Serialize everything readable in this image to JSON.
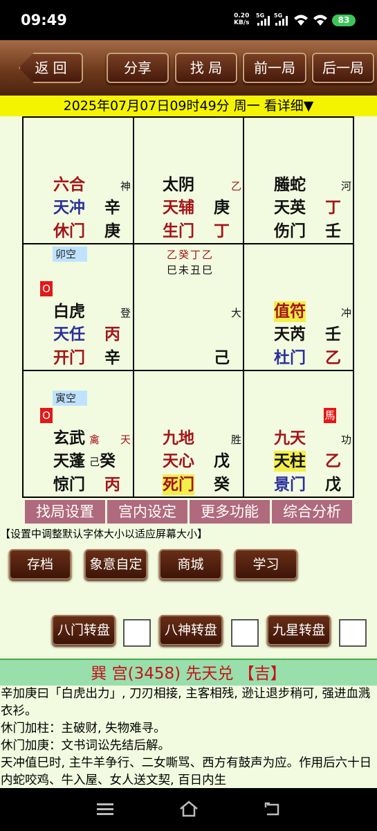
{
  "status": {
    "time": "09:49",
    "rate_value": "0.20",
    "rate_unit": "KB/s",
    "net1": "5G",
    "net2": "5G",
    "battery": "83"
  },
  "toolbar": {
    "back": "返 回",
    "share": "分享",
    "find": "找 局",
    "prev": "前一局",
    "next": "后一局"
  },
  "datebar": "2025年07月07日09时49分 周一 看详细▼",
  "grid": {
    "c00": {
      "god": "六合",
      "god_side": "神",
      "star": "天冲",
      "star_stem": "辛",
      "door": "休门",
      "door_stem": "庚"
    },
    "c01": {
      "god": "太阴",
      "god_side": "乙",
      "star": "天辅",
      "star_stem": "庚",
      "door": "生门",
      "door_stem": "丁"
    },
    "c02": {
      "god": "螣蛇",
      "god_side": "河",
      "star": "天英",
      "star_stem": "丁",
      "door": "伤门",
      "door_stem": "壬"
    },
    "c10": {
      "kong": "卯空",
      "mark": "O",
      "god": "白虎",
      "god_side": "登",
      "star": "天任",
      "star_stem": "丙",
      "door": "开门",
      "door_stem": "辛"
    },
    "c11": {
      "stems_top": "乙癸丁乙",
      "stems_bottom": "巳未丑巳",
      "side": "大",
      "bottom_stem": "己"
    },
    "c12": {
      "god": "值符",
      "god_side": "冲",
      "star": "天芮",
      "star_stem": "壬",
      "door": "杜门",
      "door_stem": "乙"
    },
    "c20": {
      "kong": "寅空",
      "mark": "O",
      "god": "玄武",
      "extra1": "禽",
      "extra2": "天",
      "star": "天蓬",
      "star_stem1": "己",
      "star_stem2": "癸",
      "door": "惊门",
      "door_stem": "丙"
    },
    "c21": {
      "god": "九地",
      "god_side": "胜",
      "star": "天心",
      "star_stem": "戊",
      "door": "死门",
      "door_stem": "癸"
    },
    "c22": {
      "horse": "馬",
      "god": "九天",
      "god_side": "功",
      "star": "天柱",
      "star_stem": "乙",
      "door": "景门",
      "door_stem": "戊"
    }
  },
  "tabs": [
    "找局设置",
    "宫内设定",
    "更多功能",
    "综合分析"
  ],
  "hint": "【设置中调整默认字体大小以适应屏幕大小】",
  "buttons": [
    "存档",
    "象意自定",
    "商城",
    "学习"
  ],
  "rotate": [
    "八门转盘",
    "八神转盘",
    "九星转盘"
  ],
  "palace": "巽 宫(3458) 先天兑 【吉】",
  "desc": [
    "辛加庚曰「白虎出力」, 刀刃相接, 主客相残, 逊让退步稍可, 强进血溅衣衫。",
    "休门加柱：主破财, 失物难寻。",
    "休门加庚：文书词讼先结后解。",
    "天冲值巳时, 主牛羊争行、二女嘶骂、西方有鼓声为应。作用后六十日内蛇咬鸡、牛入屋、女人送文契, 百日内生"
  ]
}
